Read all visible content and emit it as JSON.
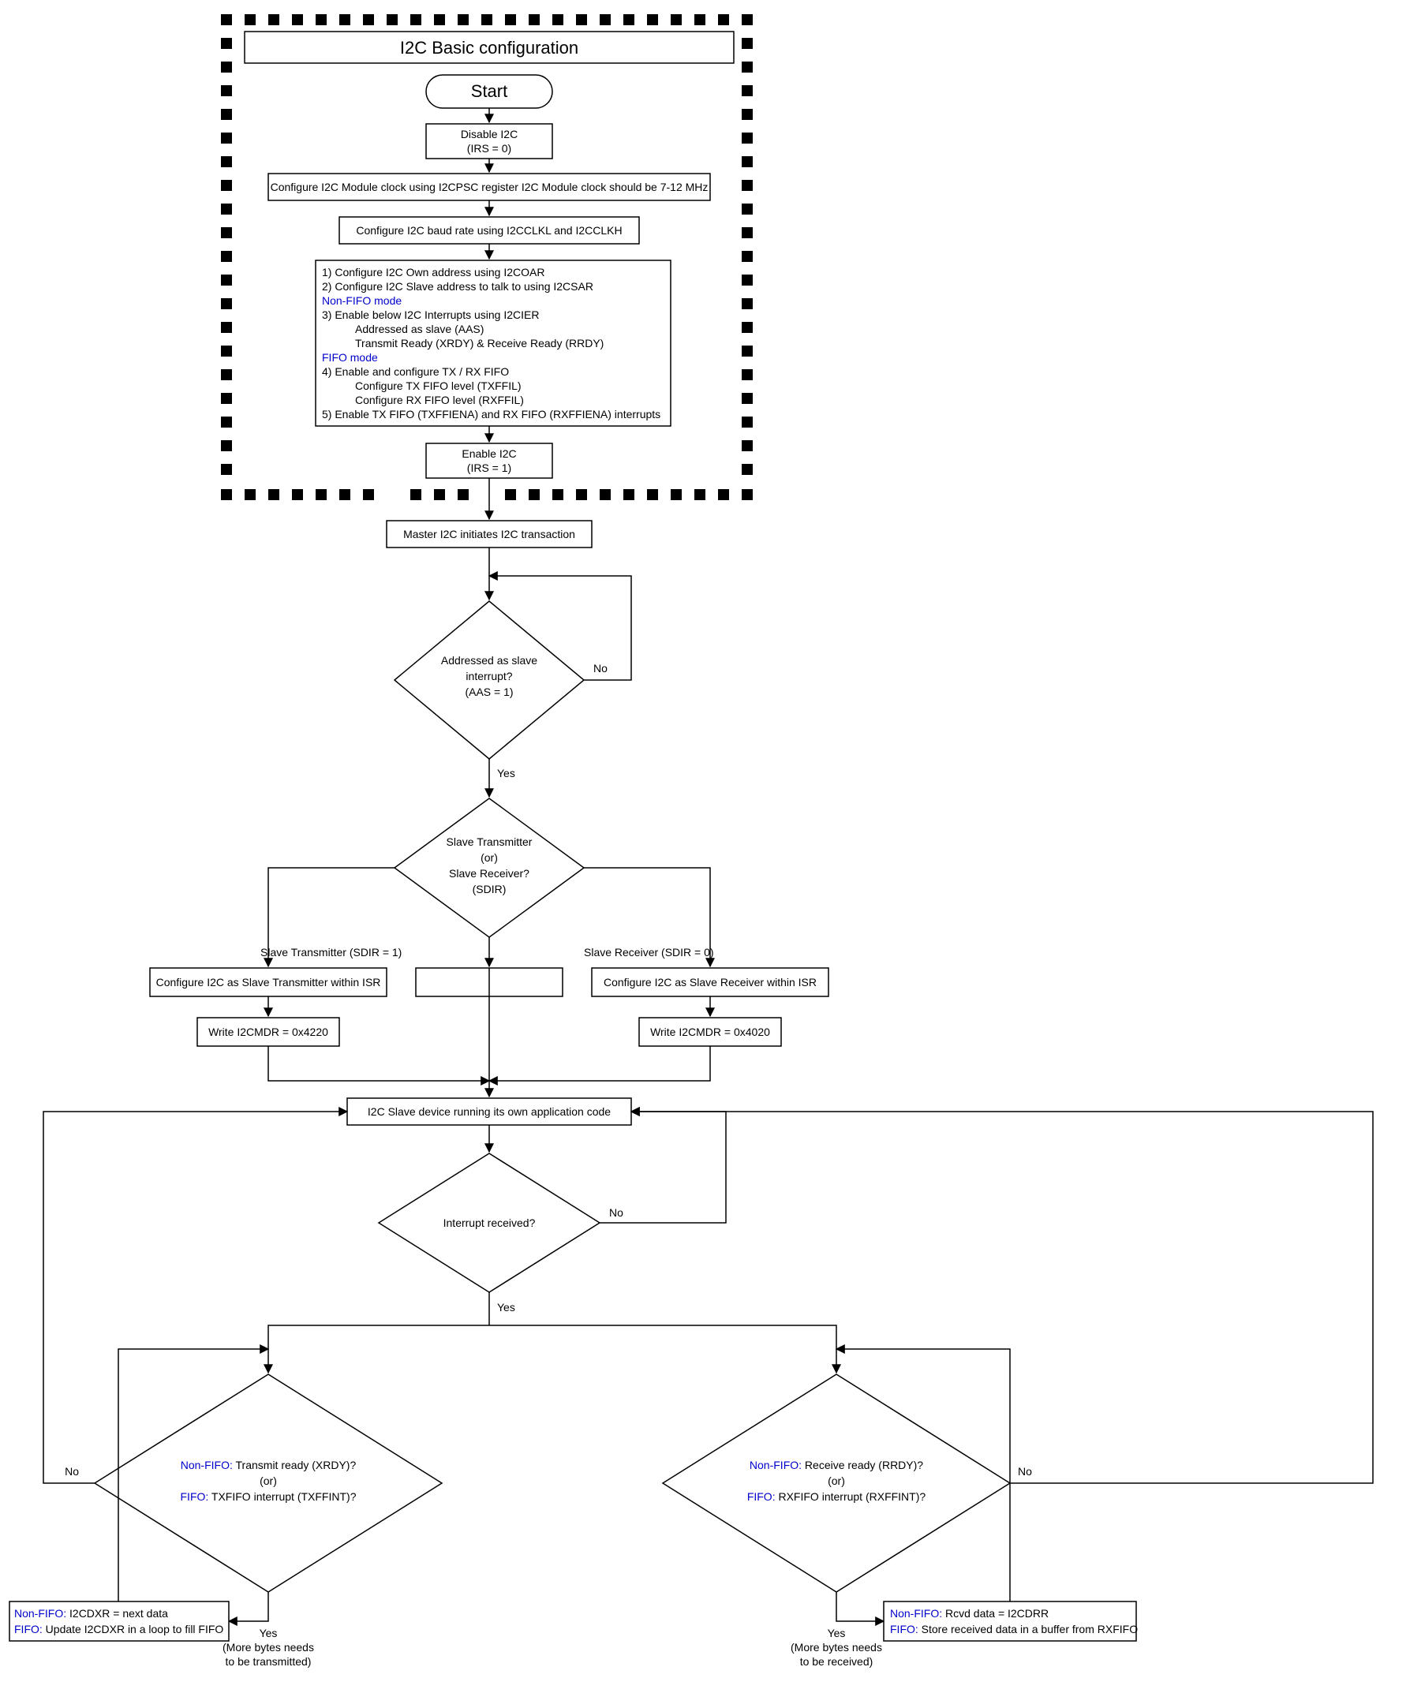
{
  "title": "I2C Basic configuration",
  "start": "Start",
  "steps": {
    "disable_l1": "Disable I2C",
    "disable_l2": "(IRS = 0)",
    "psc": "Configure I2C Module clock using I2CPSC register I2C Module clock should be 7-12 MHz",
    "baud": "Configure I2C baud rate using I2CCLKL and I2CCLKH",
    "cfg_1": "1) Configure I2C Own address using I2COAR",
    "cfg_2": "2) Configure I2C Slave address to talk to using I2CSAR",
    "cfg_nonfifo_hdr": "Non-FIFO mode",
    "cfg_3": "3) Enable below I2C Interrupts using I2CIER",
    "cfg_3a": "Addressed as slave (AAS)",
    "cfg_3b": "Transmit Ready (XRDY) & Receive Ready (RRDY)",
    "cfg_fifo_hdr": "FIFO mode",
    "cfg_4": "4) Enable and configure TX / RX FIFO",
    "cfg_4a": "Configure TX FIFO level (TXFFIL)",
    "cfg_4b": "Configure RX FIFO level (RXFFIL)",
    "cfg_5": "5) Enable TX FIFO (TXFFIENA) and RX FIFO (RXFFIENA) interrupts",
    "enable_l1": "Enable I2C",
    "enable_l2": "(IRS = 1)",
    "master_init": "Master I2C initiates I2C transaction",
    "aas_l1": "Addressed as slave",
    "aas_l2": "interrupt?",
    "aas_l3": "(AAS = 1)",
    "sdir_l1": "Slave Transmitter",
    "sdir_l2": "(or)",
    "sdir_l3": "Slave Receiver?",
    "sdir_l4": "(SDIR)",
    "cfg_tx": "Configure I2C as Slave Transmitter within ISR",
    "cfg_rx": "Configure I2C as Slave Receiver within ISR",
    "mdr_tx": "Write I2CMDR = 0x4220",
    "mdr_rx": "Write I2CMDR = 0x4020",
    "app": "I2C Slave device running its own application code",
    "intrq": "Interrupt received?",
    "tx_nf": "Non-FIFO:",
    "tx_nf_txt": " Transmit ready (XRDY)?",
    "tx_or": "(or)",
    "tx_fifo": "FIFO:",
    "tx_fifo_txt": " TXFIFO interrupt (TXFFINT)?",
    "rx_nf": "Non-FIFO:",
    "rx_nf_txt": " Receive ready (RRDY)?",
    "rx_or": "(or)",
    "rx_fifo": "FIFO:",
    "rx_fifo_txt": " RXFIFO interrupt (RXFFINT)?",
    "tx_act_nf": "Non-FIFO:",
    "tx_act_nf_txt": " I2CDXR = next data",
    "tx_act_fifo": "FIFO:",
    "tx_act_fifo_txt": " Update I2CDXR in a loop to fill FIFO",
    "rx_act_nf": "Non-FIFO:",
    "rx_act_nf_txt": " Rcvd data = I2CDRR",
    "rx_act_fifo": "FIFO:",
    "rx_act_fifo_txt": " Store received data in a buffer from RXFIFO",
    "yes_tx_l1": "Yes",
    "yes_tx_l2": "(More bytes needs",
    "yes_tx_l3": "to be transmitted)",
    "yes_rx_l1": "Yes",
    "yes_rx_l2": "(More bytes needs",
    "yes_rx_l3": "to be received)"
  },
  "labels": {
    "yes": "Yes",
    "no": "No",
    "sdir1": "Slave Transmitter (SDIR = 1)",
    "sdir0": "Slave Receiver (SDIR = 0)"
  }
}
